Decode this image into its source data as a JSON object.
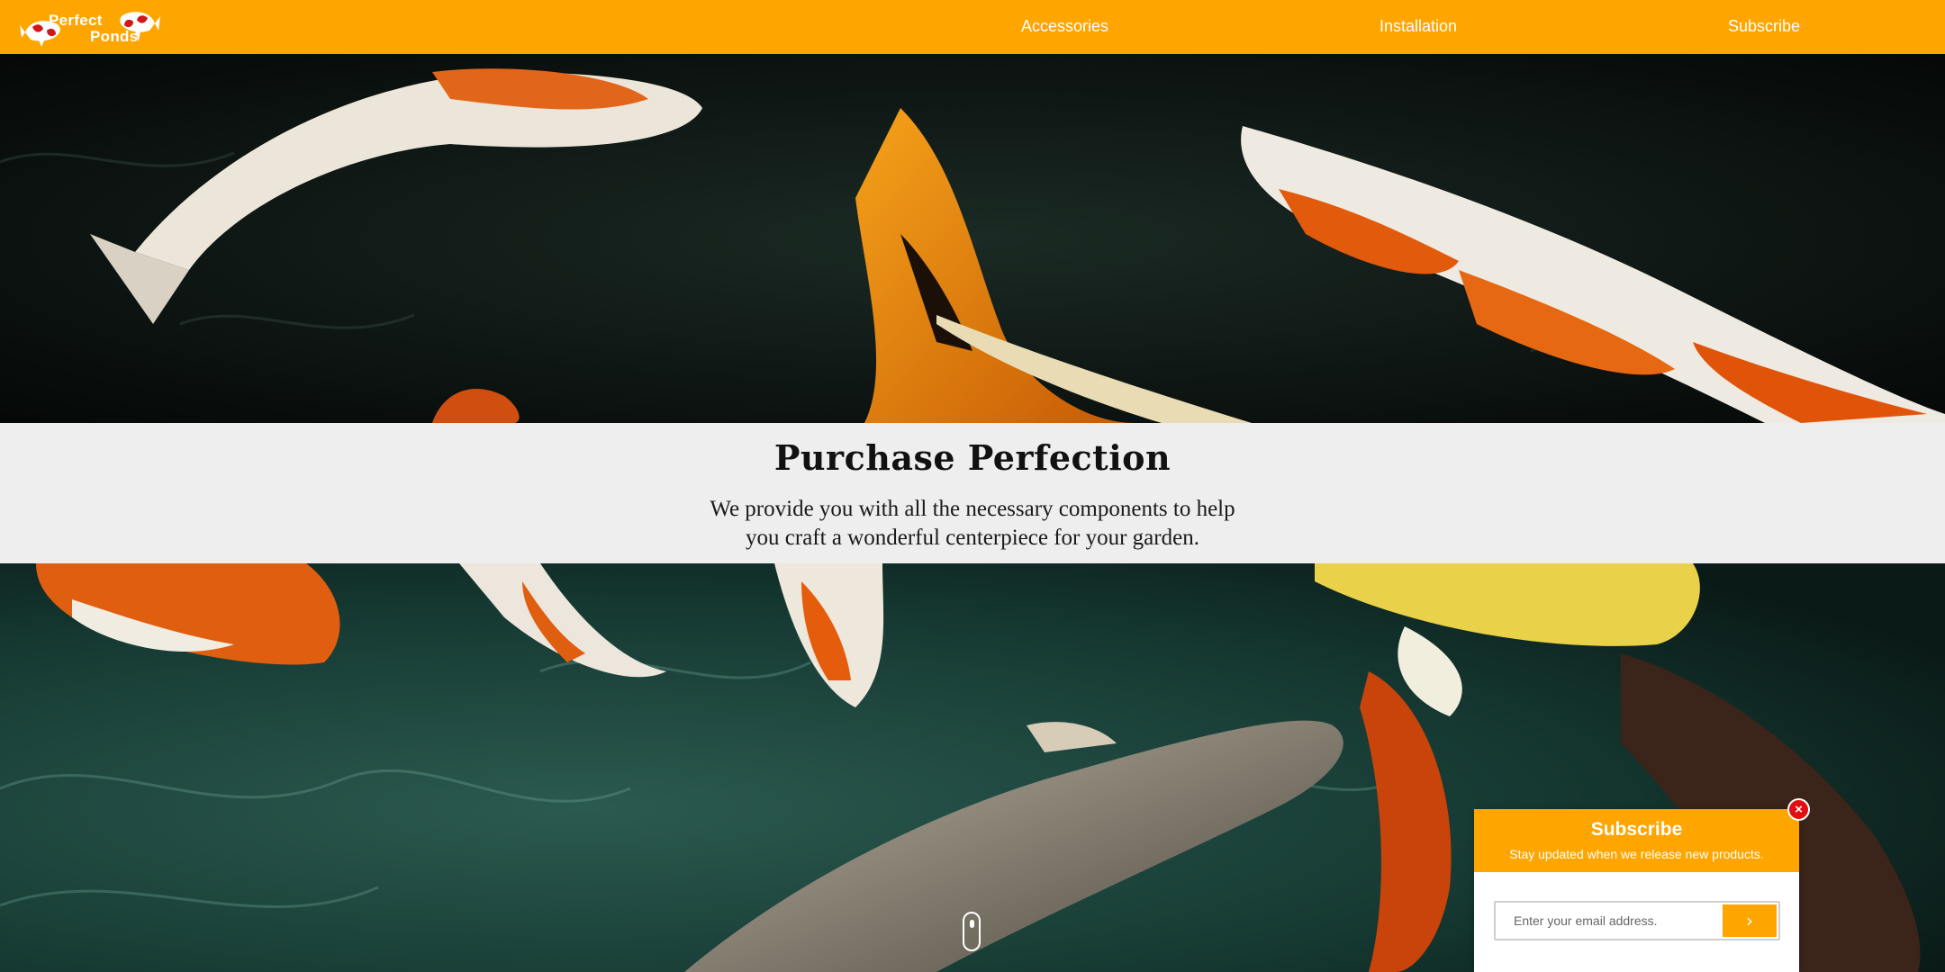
{
  "header": {
    "logo": {
      "line1": "Perfect",
      "line2": "Ponds"
    },
    "nav": [
      {
        "label": "Accessories"
      },
      {
        "label": "Installation"
      },
      {
        "label": "Subscribe"
      }
    ]
  },
  "hero_band": {
    "title": "Purchase Perfection",
    "text": "We provide you with all the necessary components to help you craft a wonderful centerpiece for your garden."
  },
  "subscribe_popup": {
    "title": "Subscribe",
    "subtitle": "Stay updated when we release new products.",
    "email_placeholder": "Enter your email address.",
    "submit_icon": "chevron-right-icon",
    "close_icon": "close-icon"
  },
  "scroll_indicator": {
    "icon": "mouse-scroll-icon"
  },
  "colors": {
    "brand": "#FFA500",
    "band_bg": "#EEEEEE",
    "close": "#E01010"
  }
}
